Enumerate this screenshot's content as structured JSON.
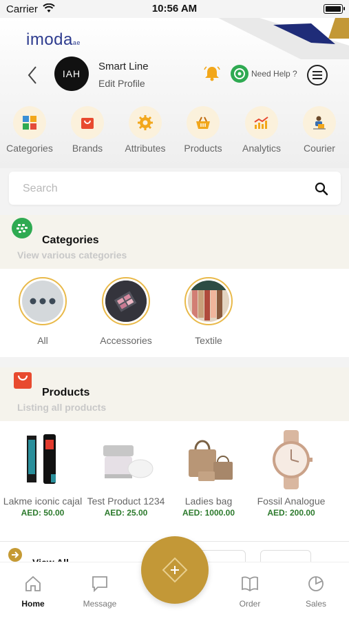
{
  "status_bar": {
    "carrier": "Carrier",
    "time": "10:56 AM"
  },
  "header": {
    "logo": "imoda",
    "logo_suffix": "ae",
    "avatar_text": "IAH",
    "store_name": "Smart Line",
    "edit_profile": "Edit Profile",
    "need_help": "Need Help ?"
  },
  "quick_actions": [
    {
      "label": "Categories",
      "icon": "categories-icon"
    },
    {
      "label": "Brands",
      "icon": "shopping-bag-icon"
    },
    {
      "label": "Attributes",
      "icon": "gear-icon"
    },
    {
      "label": "Products",
      "icon": "basket-icon"
    },
    {
      "label": "Analytics",
      "icon": "chart-icon"
    },
    {
      "label": "Courier",
      "icon": "courier-icon"
    }
  ],
  "search": {
    "placeholder": "Search"
  },
  "categories_section": {
    "title": "Categories",
    "subtitle": "View various categories",
    "items": [
      {
        "label": "All"
      },
      {
        "label": "Accessories"
      },
      {
        "label": "Textile"
      }
    ]
  },
  "products_section": {
    "title": "Products",
    "subtitle": "Listing all products",
    "items": [
      {
        "name": "Lakme iconic cajal",
        "price": "AED: 50.00"
      },
      {
        "name": "Test Product 1234",
        "price": "AED: 25.00"
      },
      {
        "name": "Ladies bag",
        "price": "AED: 1000.00"
      },
      {
        "name": "Fossil Analogue",
        "price": "AED: 200.00"
      }
    ]
  },
  "view_all": {
    "label": "View All"
  },
  "tab_bar": [
    {
      "label": "Home",
      "icon": "home-icon",
      "active": true
    },
    {
      "label": "Message",
      "icon": "message-icon",
      "active": false
    },
    {
      "label": "Order",
      "icon": "book-icon",
      "active": false
    },
    {
      "label": "Sales",
      "icon": "pie-chart-icon",
      "active": false
    }
  ],
  "colors": {
    "accent": "#c39837",
    "price": "#2c7a2c",
    "brand": "#2d3b8e",
    "section_bg": "#f5f3ec"
  }
}
